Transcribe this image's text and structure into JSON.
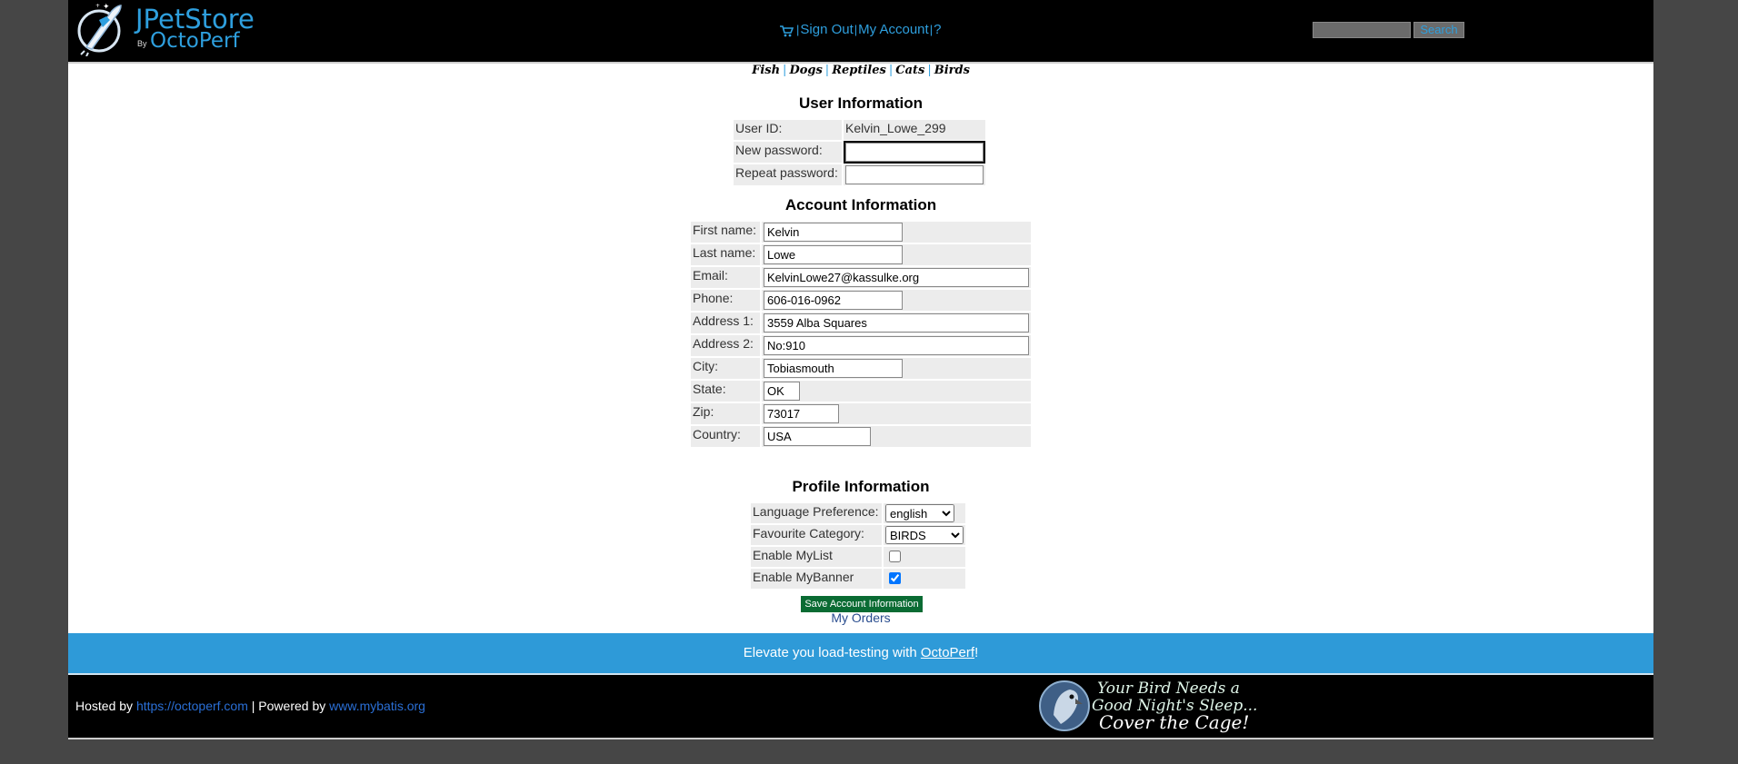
{
  "header": {
    "brand_primary": "JPetStore",
    "brand_by": "By",
    "brand_secondary": "OctoPerf",
    "menu": {
      "sign_out": "Sign Out",
      "my_account": "My Account",
      "help": "?",
      "separator": "|"
    },
    "search": {
      "value": "",
      "button_label": "Search"
    }
  },
  "categories": [
    "Fish",
    "Dogs",
    "Reptiles",
    "Cats",
    "Birds"
  ],
  "user_info": {
    "title": "User Information",
    "user_id_label": "User ID:",
    "user_id_value": "Kelvin_Lowe_299",
    "new_password_label": "New password:",
    "new_password_value": "",
    "repeat_password_label": "Repeat password:",
    "repeat_password_value": ""
  },
  "account_info": {
    "title": "Account Information",
    "fields": {
      "first_name": {
        "label": "First name:",
        "value": "Kelvin"
      },
      "last_name": {
        "label": "Last name:",
        "value": "Lowe"
      },
      "email": {
        "label": "Email:",
        "value": "KelvinLowe27@kassulke.org"
      },
      "phone": {
        "label": "Phone:",
        "value": "606-016-0962"
      },
      "address1": {
        "label": "Address 1:",
        "value": "3559 Alba Squares"
      },
      "address2": {
        "label": "Address 2:",
        "value": "No:910"
      },
      "city": {
        "label": "City:",
        "value": "Tobiasmouth"
      },
      "state": {
        "label": "State:",
        "value": "OK"
      },
      "zip": {
        "label": "Zip:",
        "value": "73017"
      },
      "country": {
        "label": "Country:",
        "value": "USA"
      }
    }
  },
  "profile_info": {
    "title": "Profile Information",
    "language_label": "Language Preference:",
    "language_value": "english",
    "category_label": "Favourite Category:",
    "category_value": "BIRDS",
    "mylist_label": "Enable MyList",
    "mylist_checked": false,
    "mybanner_label": "Enable MyBanner",
    "mybanner_checked": true
  },
  "actions": {
    "save_label": "Save Account Information",
    "my_orders_label": "My Orders"
  },
  "banner": {
    "text_before": "Elevate you load-testing with ",
    "link": "OctoPerf",
    "text_after": "!"
  },
  "footer": {
    "hosted_by": "Hosted by ",
    "hosted_link": "https://octoperf.com",
    "powered_by": " | Powered by ",
    "powered_link": "www.mybatis.org",
    "ad_lines": [
      "Your Bird Needs a",
      "Good Night's Sleep...",
      "Cover the Cage!"
    ]
  },
  "colors": {
    "accent_blue": "#2e9fde",
    "banner_blue": "#2e9ad8",
    "save_green": "#0a6b33",
    "row_gray": "#ececec"
  }
}
